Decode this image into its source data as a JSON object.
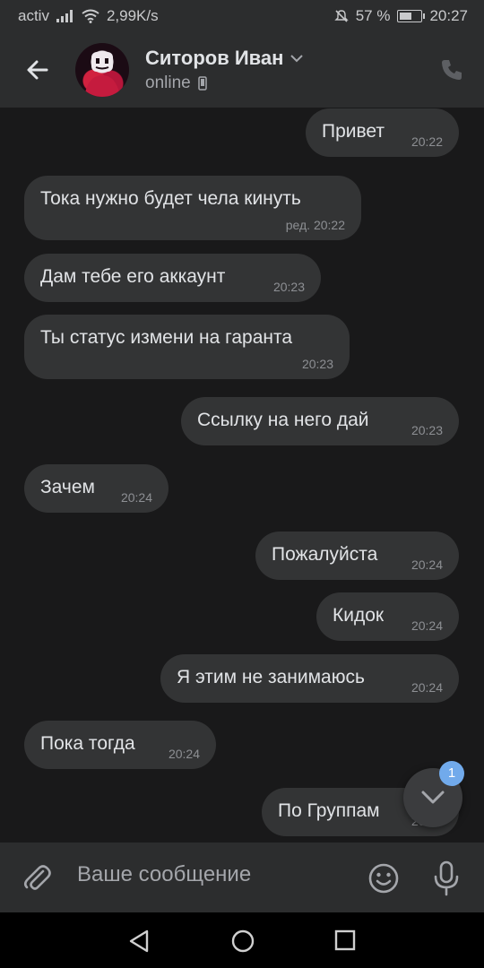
{
  "status_bar": {
    "carrier": "activ",
    "network_speed": "2,99K/s",
    "battery_percent": "57 %",
    "time": "20:27"
  },
  "header": {
    "contact_name": "Ситоров Иван",
    "contact_status": "online"
  },
  "messages": [
    {
      "text": "Привет",
      "time": "20:22",
      "outgoing": true
    },
    {
      "text": "Тока нужно будет чела кинуть",
      "time": "ред. 20:22",
      "outgoing": false
    },
    {
      "text": "Дам тебе его аккаунт",
      "time": "20:23",
      "outgoing": false
    },
    {
      "text": "Ты статус измени на гаранта",
      "time": "20:23",
      "outgoing": false
    },
    {
      "text": "Ссылку на него дай",
      "time": "20:23",
      "outgoing": true
    },
    {
      "text": "Зачем",
      "time": "20:24",
      "outgoing": false
    },
    {
      "text": "Пожалуйста",
      "time": "20:24",
      "outgoing": true
    },
    {
      "text": "Кидок",
      "time": "20:24",
      "outgoing": true
    },
    {
      "text": "Я этим не занимаюсь",
      "time": "20:24",
      "outgoing": true
    },
    {
      "text": "Пока тогда",
      "time": "20:24",
      "outgoing": false
    },
    {
      "text": "По Группам",
      "time": "20:24",
      "outgoing": true
    }
  ],
  "scroll_down": {
    "unread_count": "1"
  },
  "composer": {
    "placeholder": "Ваше сообщение"
  },
  "colors": {
    "background": "#19191a",
    "bubble": "#333435",
    "bar": "#2c2d2e",
    "accent": "#71aaeb"
  }
}
